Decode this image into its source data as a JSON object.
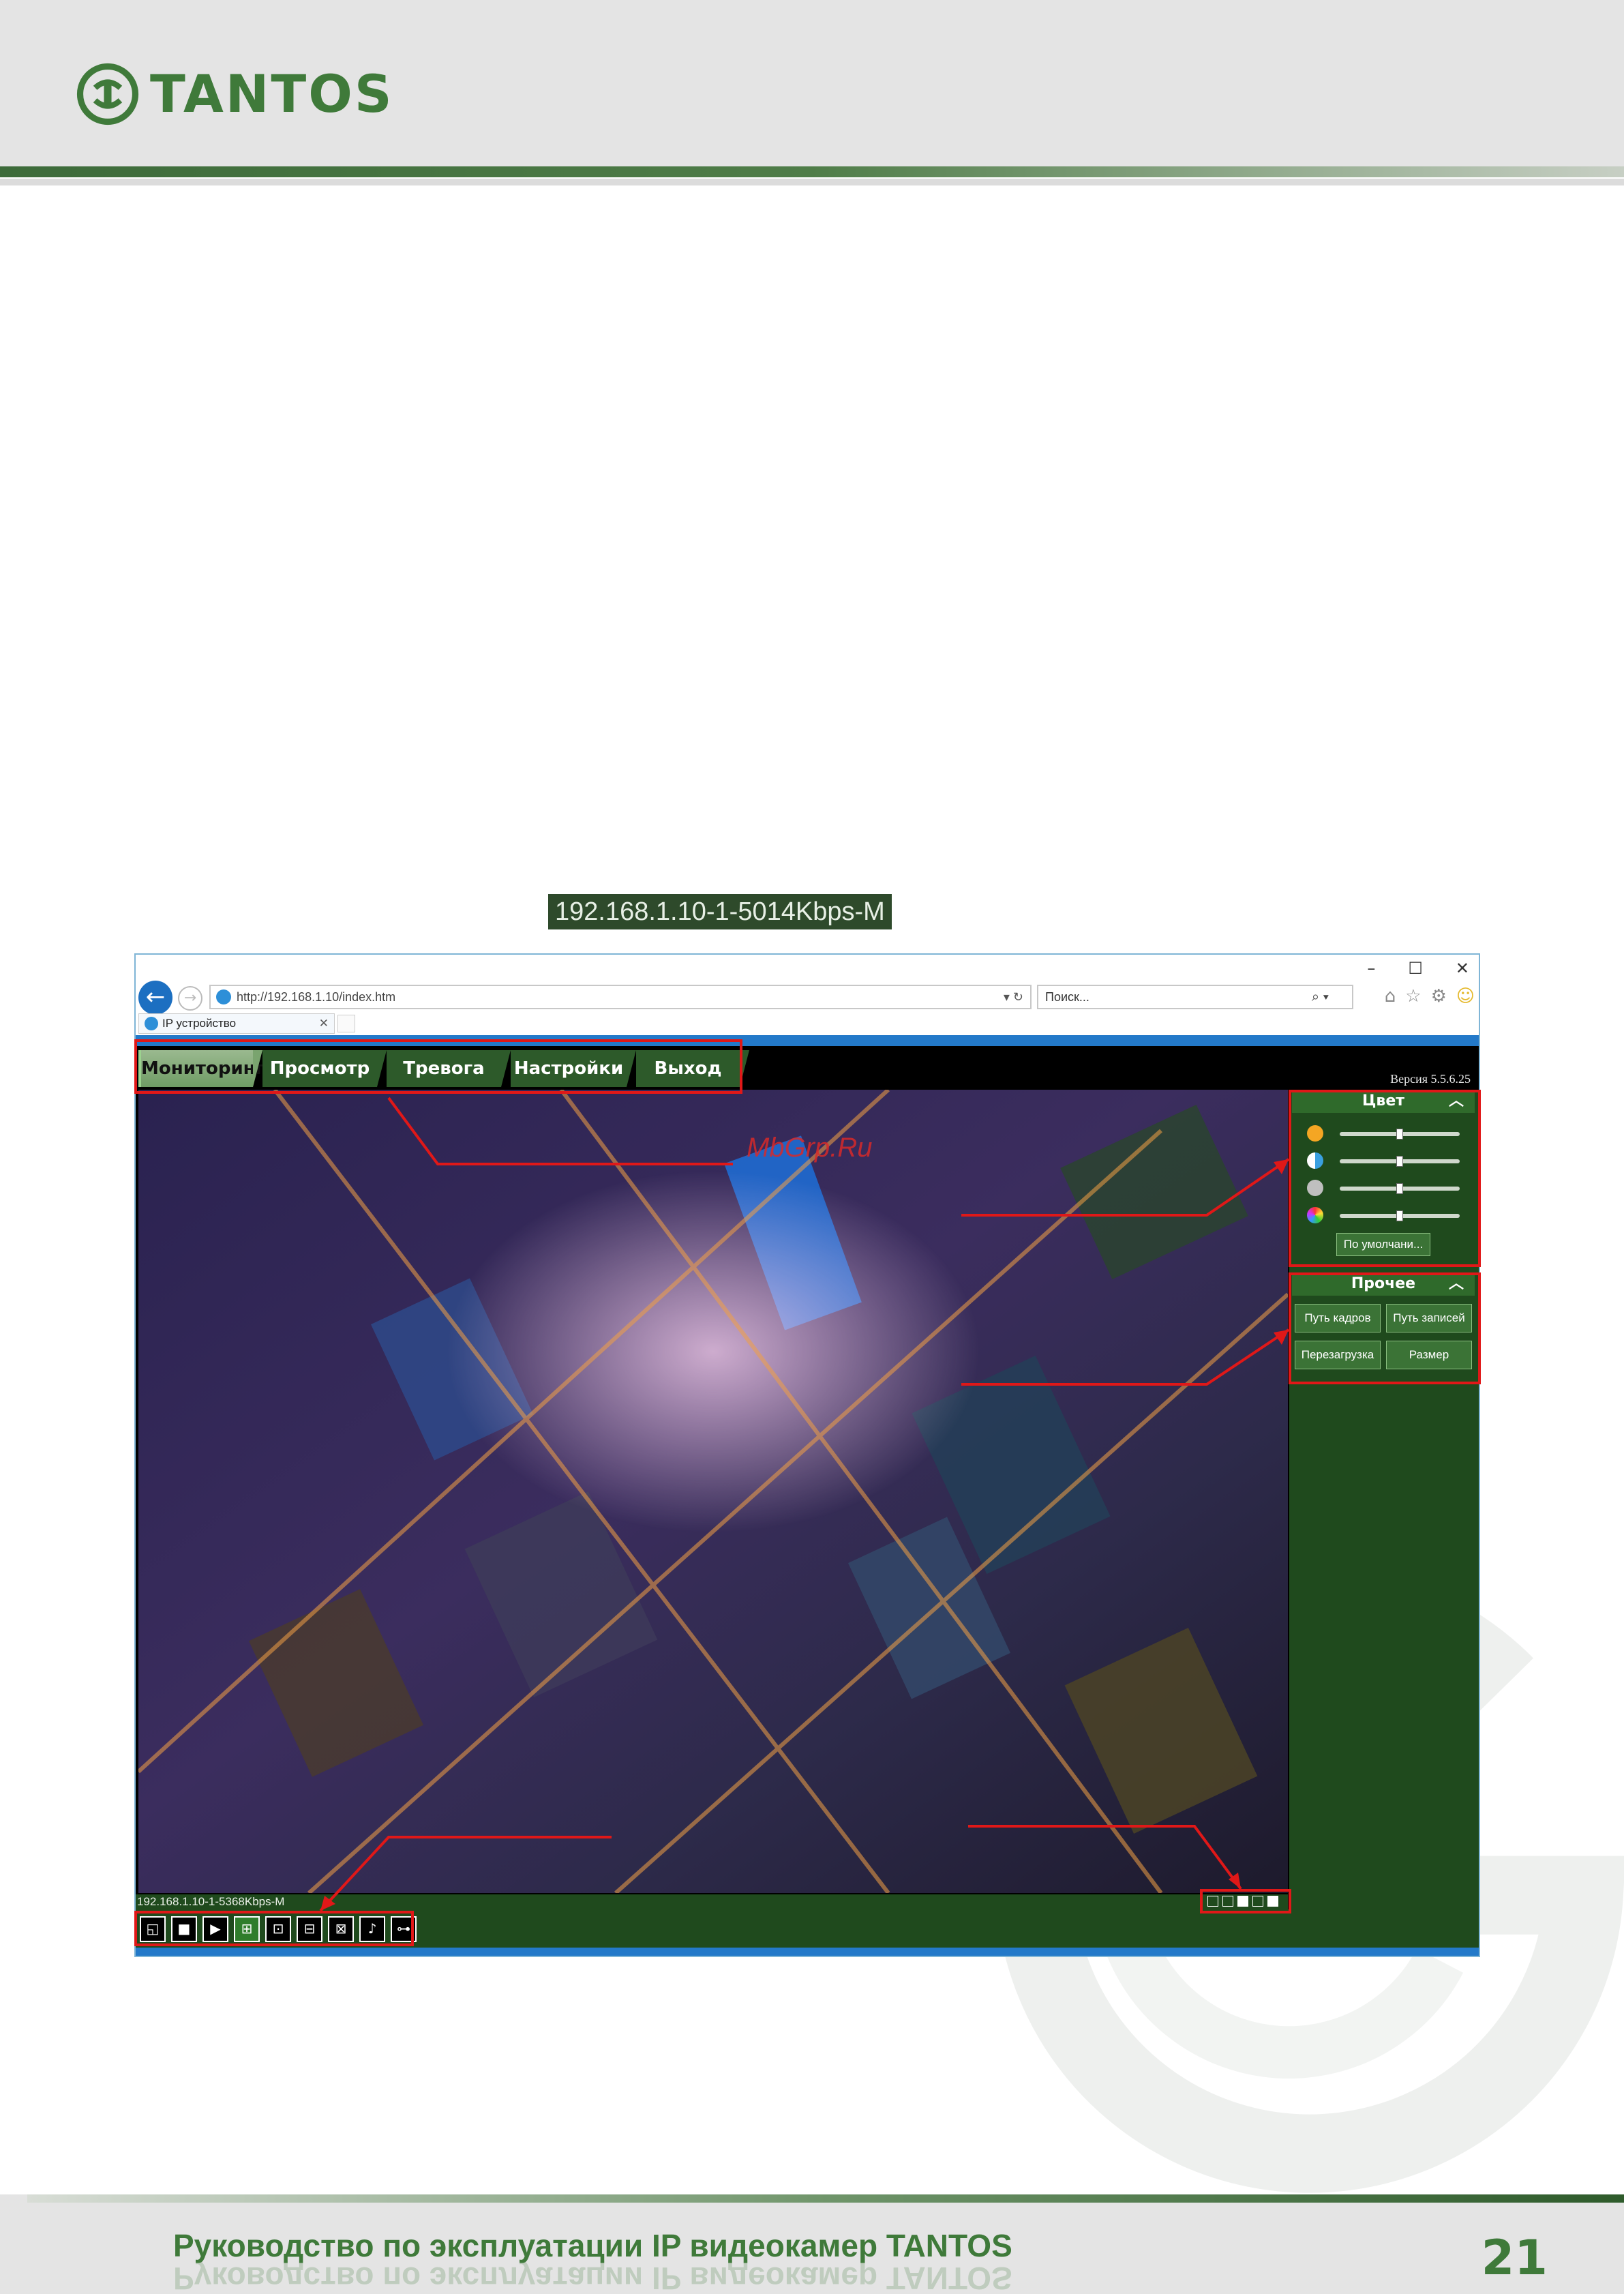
{
  "brand": {
    "name": "TANTOS",
    "accent": "#3f7a3a"
  },
  "stream_label": "192.168.1.10-1-5014Kbps-M",
  "browser": {
    "url": "http://192.168.1.10/index.htm",
    "url_host": "192.168.1.10",
    "search_placeholder": "Поиск...",
    "tab_title": "IP устройство",
    "window_controls": [
      "–",
      "☐",
      "✕"
    ]
  },
  "camera_ui": {
    "menu": [
      "Мониторинг",
      "Просмотр",
      "Тревога",
      "Настройки",
      "Выход"
    ],
    "active_menu": "Мониторинг",
    "version": "Версия 5.5.6.25",
    "watermark": "MbGrp.Ru",
    "stream_status": "192.168.1.10-1-5368Kbps-M",
    "panels": {
      "color": {
        "title": "Цвет",
        "sliders": [
          {
            "icon": "brightness-icon",
            "color": "#f5a623",
            "level": 0.5
          },
          {
            "icon": "contrast-icon",
            "color": "#3aa0e0",
            "level": 0.5
          },
          {
            "icon": "saturation-icon",
            "color": "#bfbfbf",
            "level": 0.5
          },
          {
            "icon": "hue-icon",
            "color": "#e6a2d8",
            "level": 0.5
          }
        ],
        "default_button": "По умолчани..."
      },
      "other": {
        "title": "Прочее",
        "buttons": [
          "Путь кадров",
          "Путь записей",
          "Перезагрузка",
          "Размер"
        ]
      }
    },
    "controls": [
      "layout-1-icon",
      "layout-single-icon",
      "play-icon",
      "snapshot-icon",
      "record-icon",
      "record-settings-icon",
      "record-stop-icon",
      "microphone-icon",
      "network-icon"
    ],
    "controls_glyphs": [
      "◱",
      "■",
      "▶",
      "⊞",
      "⊡",
      "⊟",
      "⊠",
      "♪",
      "⊶"
    ]
  },
  "footer": {
    "title": "Руководство по эксплуатации IP видеокамер TANTOS",
    "page_number": "21"
  }
}
